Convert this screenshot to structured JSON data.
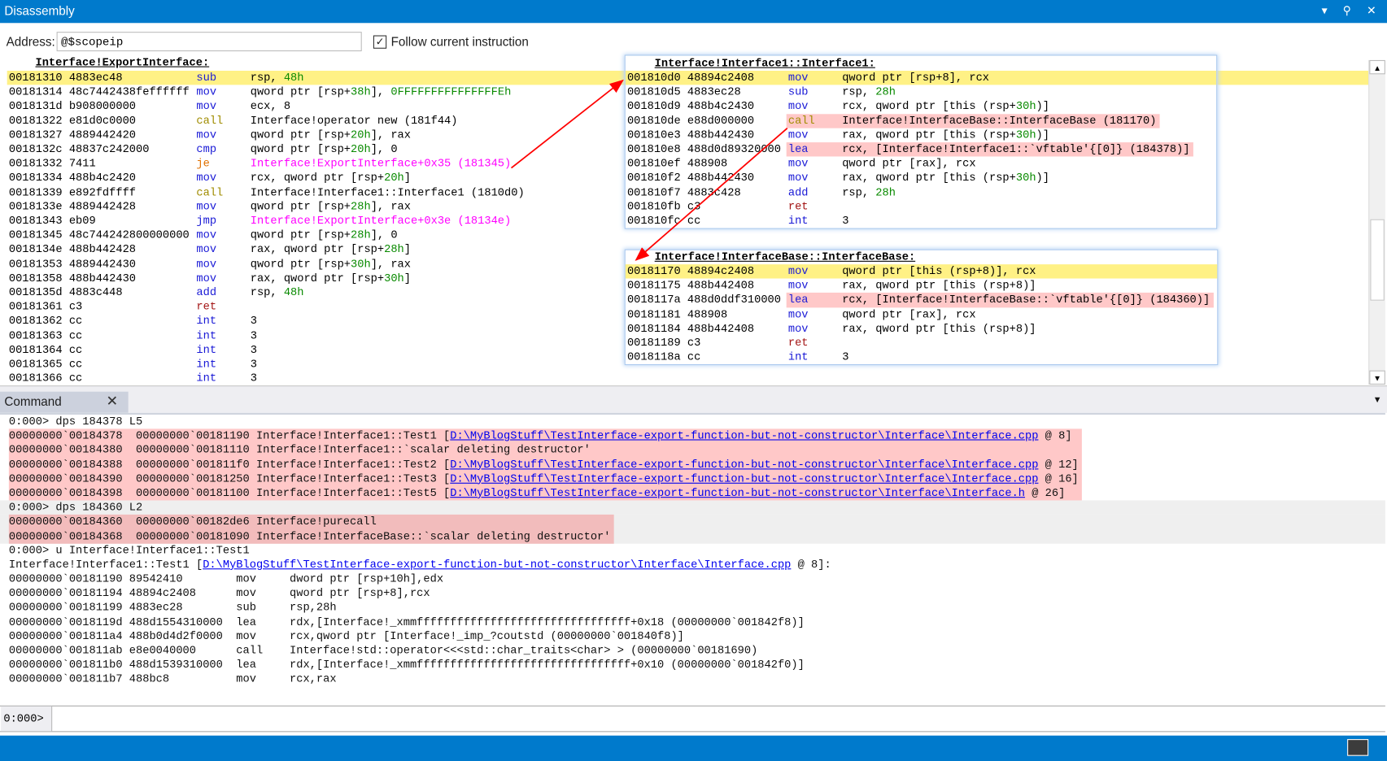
{
  "window": {
    "title": "Disassembly",
    "buttons": {
      "dropdown": "▾",
      "pin": "⚲",
      "close": "✕"
    }
  },
  "address": {
    "label": "Address:",
    "value": "@$scopeip",
    "follow_label": "Follow current instruction",
    "follow_checked": true
  },
  "main": {
    "header": "Interface!ExportInterface:",
    "rows": [
      {
        "a": "00181310 4883ec48",
        "m": "sub",
        "mc": "blue",
        "ops": [
          [
            "rsp, ",
            ""
          ],
          [
            "48h",
            "num"
          ]
        ],
        "cur": true
      },
      {
        "a": "00181314 48c7442438feffffff",
        "m": "mov",
        "mc": "blue",
        "ops": [
          [
            "qword ptr [rsp+",
            ""
          ],
          [
            "38h",
            "num"
          ],
          [
            "], ",
            ""
          ],
          [
            "0FFFFFFFFFFFFFFFEh",
            "num"
          ]
        ]
      },
      {
        "a": "0018131d b908000000",
        "m": "mov",
        "mc": "blue",
        "ops": [
          [
            "ecx, 8",
            ""
          ]
        ]
      },
      {
        "a": "00181322 e81d0c0000",
        "m": "call",
        "mc": "call",
        "ops": [
          [
            "Interface!operator new (181f44)",
            ""
          ]
        ]
      },
      {
        "a": "00181327 4889442420",
        "m": "mov",
        "mc": "blue",
        "ops": [
          [
            "qword ptr [rsp+",
            ""
          ],
          [
            "20h",
            "num"
          ],
          [
            "], rax",
            ""
          ]
        ]
      },
      {
        "a": "0018132c 48837c242000",
        "m": "cmp",
        "mc": "blue",
        "ops": [
          [
            "qword ptr [rsp+",
            ""
          ],
          [
            "20h",
            "num"
          ],
          [
            "], 0",
            ""
          ]
        ]
      },
      {
        "a": "00181332 7411",
        "m": "je",
        "mc": "je",
        "ops": [
          [
            "Interface!ExportInterface+0x35 (181345)",
            "tgt"
          ]
        ]
      },
      {
        "a": "00181334 488b4c2420",
        "m": "mov",
        "mc": "blue",
        "ops": [
          [
            "rcx, qword ptr [rsp+",
            ""
          ],
          [
            "20h",
            "num"
          ],
          [
            "]",
            ""
          ]
        ]
      },
      {
        "a": "00181339 e892fdffff",
        "m": "call",
        "mc": "call",
        "ops": [
          [
            "Interface!Interface1::Interface1 (1810d0)",
            ""
          ]
        ]
      },
      {
        "a": "0018133e 4889442428",
        "m": "mov",
        "mc": "blue",
        "ops": [
          [
            "qword ptr [rsp+",
            ""
          ],
          [
            "28h",
            "num"
          ],
          [
            "], rax",
            ""
          ]
        ]
      },
      {
        "a": "00181343 eb09",
        "m": "jmp",
        "mc": "blue",
        "ops": [
          [
            "Interface!ExportInterface+0x3e (18134e)",
            "tgt"
          ]
        ]
      },
      {
        "a": "00181345 48c744242800000000",
        "m": "mov",
        "mc": "blue",
        "ops": [
          [
            "qword ptr [rsp+",
            ""
          ],
          [
            "28h",
            "num"
          ],
          [
            "], 0",
            ""
          ]
        ]
      },
      {
        "a": "0018134e 488b442428",
        "m": "mov",
        "mc": "blue",
        "ops": [
          [
            "rax, qword ptr [rsp+",
            ""
          ],
          [
            "28h",
            "num"
          ],
          [
            "]",
            ""
          ]
        ]
      },
      {
        "a": "00181353 4889442430",
        "m": "mov",
        "mc": "blue",
        "ops": [
          [
            "qword ptr [rsp+",
            ""
          ],
          [
            "30h",
            "num"
          ],
          [
            "], rax",
            ""
          ]
        ]
      },
      {
        "a": "00181358 488b442430",
        "m": "mov",
        "mc": "blue",
        "ops": [
          [
            "rax, qword ptr [rsp+",
            ""
          ],
          [
            "30h",
            "num"
          ],
          [
            "]",
            ""
          ]
        ]
      },
      {
        "a": "0018135d 4883c448",
        "m": "add",
        "mc": "blue",
        "ops": [
          [
            "rsp, ",
            ""
          ],
          [
            "48h",
            "num"
          ]
        ]
      },
      {
        "a": "00181361 c3",
        "m": "ret",
        "mc": "ret",
        "ops": []
      },
      {
        "a": "00181362 cc",
        "m": "int",
        "mc": "blue",
        "ops": [
          [
            "3",
            ""
          ]
        ]
      },
      {
        "a": "00181363 cc",
        "m": "int",
        "mc": "blue",
        "ops": [
          [
            "3",
            ""
          ]
        ]
      },
      {
        "a": "00181364 cc",
        "m": "int",
        "mc": "blue",
        "ops": [
          [
            "3",
            ""
          ]
        ]
      },
      {
        "a": "00181365 cc",
        "m": "int",
        "mc": "blue",
        "ops": [
          [
            "3",
            ""
          ]
        ]
      },
      {
        "a": "00181366 cc",
        "m": "int",
        "mc": "blue",
        "ops": [
          [
            "3",
            ""
          ]
        ]
      }
    ]
  },
  "popups": [
    {
      "header": "Interface!Interface1::Interface1:",
      "rows": [
        {
          "a": "001810d0 48894c2408",
          "m": "mov",
          "mc": "blue",
          "ops": [
            [
              "qword ptr [rsp+8], rcx",
              ""
            ]
          ],
          "cur": true
        },
        {
          "a": "001810d5 4883ec28",
          "m": "sub",
          "mc": "blue",
          "ops": [
            [
              "rsp, ",
              ""
            ],
            [
              "28h",
              "num"
            ]
          ]
        },
        {
          "a": "001810d9 488b4c2430",
          "m": "mov",
          "mc": "blue",
          "ops": [
            [
              "rcx, qword ptr [this (rsp+",
              ""
            ],
            [
              "30h",
              "num"
            ],
            [
              ")]",
              ""
            ]
          ]
        },
        {
          "a": "001810de e88d000000",
          "m": "call",
          "mc": "call",
          "ops": [
            [
              "Interface!InterfaceBase::InterfaceBase (181170)",
              ""
            ]
          ],
          "hl": true
        },
        {
          "a": "001810e3 488b442430",
          "m": "mov",
          "mc": "blue",
          "ops": [
            [
              "rax, qword ptr [this (rsp+",
              ""
            ],
            [
              "30h",
              "num"
            ],
            [
              ")]",
              ""
            ]
          ]
        },
        {
          "a": "001810e8 488d0d89320000",
          "m": "lea",
          "mc": "blue",
          "ops": [
            [
              "rcx, [Interface!Interface1::`vftable'{[0]} (184378)]",
              ""
            ]
          ],
          "hl": true
        },
        {
          "a": "001810ef 488908",
          "m": "mov",
          "mc": "blue",
          "ops": [
            [
              "qword ptr [rax], rcx",
              ""
            ]
          ]
        },
        {
          "a": "001810f2 488b442430",
          "m": "mov",
          "mc": "blue",
          "ops": [
            [
              "rax, qword ptr [this (rsp+",
              ""
            ],
            [
              "30h",
              "num"
            ],
            [
              ")]",
              ""
            ]
          ]
        },
        {
          "a": "001810f7 4883c428",
          "m": "add",
          "mc": "blue",
          "ops": [
            [
              "rsp, ",
              ""
            ],
            [
              "28h",
              "num"
            ]
          ]
        },
        {
          "a": "001810fb c3",
          "m": "ret",
          "mc": "ret",
          "ops": []
        },
        {
          "a": "001810fc cc",
          "m": "int",
          "mc": "blue",
          "ops": [
            [
              "3",
              ""
            ]
          ]
        }
      ]
    },
    {
      "header": "Interface!InterfaceBase::InterfaceBase:",
      "rows": [
        {
          "a": "00181170 48894c2408",
          "m": "mov",
          "mc": "blue",
          "ops": [
            [
              "qword ptr [this (rsp+8)], rcx",
              ""
            ]
          ],
          "cur": true
        },
        {
          "a": "00181175 488b442408",
          "m": "mov",
          "mc": "blue",
          "ops": [
            [
              "rax, qword ptr [this (rsp+8)]",
              ""
            ]
          ]
        },
        {
          "a": "0018117a 488d0ddf310000",
          "m": "lea",
          "mc": "blue",
          "ops": [
            [
              "rcx, [Interface!InterfaceBase::`vftable'{[0]} (184360)]",
              ""
            ]
          ],
          "hl": true
        },
        {
          "a": "00181181 488908",
          "m": "mov",
          "mc": "blue",
          "ops": [
            [
              "qword ptr [rax], rcx",
              ""
            ]
          ]
        },
        {
          "a": "00181184 488b442408",
          "m": "mov",
          "mc": "blue",
          "ops": [
            [
              "rax, qword ptr [this (rsp+8)]",
              ""
            ]
          ]
        },
        {
          "a": "00181189 c3",
          "m": "ret",
          "mc": "ret",
          "ops": []
        },
        {
          "a": "0018118a cc",
          "m": "int",
          "mc": "blue",
          "ops": [
            [
              "3",
              ""
            ]
          ]
        }
      ]
    }
  ],
  "colors": {
    "accent": "#007acc",
    "current_line": "#fff185",
    "highlight": "#ffc8c8",
    "arrow": "#ff0000"
  },
  "command": {
    "tab_label": "Command",
    "output": [
      {
        "type": "line",
        "segs": [
          [
            "0:000> dps 184378 L5",
            ""
          ]
        ]
      },
      {
        "type": "block",
        "style": "p1",
        "lines": [
          [
            [
              "00000000`00184378  00000000`00181190 Interface!Interface1::Test1 [",
              ""
            ],
            [
              "D:\\MyBlogStuff\\TestInterface-export-function-but-not-constructor\\Interface\\Interface.cpp",
              "link"
            ],
            [
              " @ 8]",
              ""
            ]
          ],
          [
            [
              "00000000`00184380  00000000`00181110 Interface!Interface1::`scalar deleting destructor'",
              ""
            ]
          ],
          [
            [
              "00000000`00184388  00000000`001811f0 Interface!Interface1::Test2 [",
              ""
            ],
            [
              "D:\\MyBlogStuff\\TestInterface-export-function-but-not-constructor\\Interface\\Interface.cpp",
              "link"
            ],
            [
              " @ 12]",
              ""
            ]
          ],
          [
            [
              "00000000`00184390  00000000`00181250 Interface!Interface1::Test3 [",
              ""
            ],
            [
              "D:\\MyBlogStuff\\TestInterface-export-function-but-not-constructor\\Interface\\Interface.cpp",
              "link"
            ],
            [
              " @ 16]",
              ""
            ]
          ],
          [
            [
              "00000000`00184398  00000000`00181100 Interface!Interface1::Test5 [",
              ""
            ],
            [
              "D:\\MyBlogStuff\\TestInterface-export-function-but-not-constructor\\Interface\\Interface.h",
              "link"
            ],
            [
              " @ 26]",
              ""
            ]
          ]
        ]
      },
      {
        "type": "line",
        "gray": true,
        "segs": [
          [
            "0:000> dps 184360 L2",
            ""
          ]
        ]
      },
      {
        "type": "block",
        "style": "p2",
        "gray": true,
        "lines": [
          [
            [
              "00000000`00184360  00000000`00182de6 Interface!purecall",
              ""
            ]
          ],
          [
            [
              "00000000`00184368  00000000`00181090 Interface!InterfaceBase::`scalar deleting destructor'",
              ""
            ]
          ]
        ]
      },
      {
        "type": "line",
        "segs": [
          [
            "0:000> u Interface!Interface1::Test1",
            ""
          ]
        ]
      },
      {
        "type": "line",
        "segs": [
          [
            "Interface!Interface1::Test1 [",
            ""
          ],
          [
            "D:\\MyBlogStuff\\TestInterface-export-function-but-not-constructor\\Interface\\Interface.cpp",
            "link"
          ],
          [
            " @ 8]:",
            ""
          ]
        ]
      },
      {
        "type": "line",
        "segs": [
          [
            "00000000`00181190 89542410        mov     dword ptr [rsp+10h],edx",
            ""
          ]
        ]
      },
      {
        "type": "line",
        "segs": [
          [
            "00000000`00181194 48894c2408      mov     qword ptr [rsp+8],rcx",
            ""
          ]
        ]
      },
      {
        "type": "line",
        "segs": [
          [
            "00000000`00181199 4883ec28        sub     rsp,28h",
            ""
          ]
        ]
      },
      {
        "type": "line",
        "segs": [
          [
            "00000000`0018119d 488d1554310000  lea     rdx,[Interface!_xmmffffffffffffffffffffffffffffffff+0x18 (00000000`001842f8)]",
            ""
          ]
        ]
      },
      {
        "type": "line",
        "segs": [
          [
            "00000000`001811a4 488b0d4d2f0000  mov     rcx,qword ptr [Interface!_imp_?coutstd (00000000`001840f8)]",
            ""
          ]
        ]
      },
      {
        "type": "line",
        "segs": [
          [
            "00000000`001811ab e8e0040000      call    Interface!std::operator<<<std::char_traits<char> > (00000000`00181690)",
            ""
          ]
        ]
      },
      {
        "type": "line",
        "segs": [
          [
            "00000000`001811b0 488d1539310000  lea     rdx,[Interface!_xmmffffffffffffffffffffffffffffffff+0x10 (00000000`001842f0)]",
            ""
          ]
        ]
      },
      {
        "type": "line",
        "segs": [
          [
            "00000000`001811b7 488bc8          mov     rcx,rax",
            ""
          ]
        ]
      }
    ],
    "prompt": "0:000>",
    "input_value": ""
  }
}
